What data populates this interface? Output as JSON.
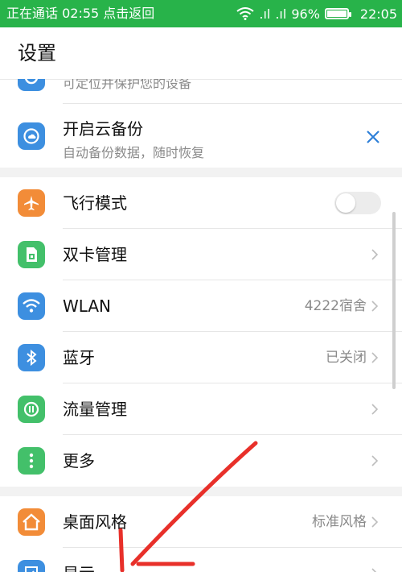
{
  "status_bar": {
    "left_text": "正在通话 02:55 点击返回",
    "signal_1": ".ıl",
    "signal_2": ".ıl",
    "battery_percent": "96%",
    "time": "22:05"
  },
  "header": {
    "title": "设置"
  },
  "partial_row": {
    "subtitle": "可定位并保护您的设备"
  },
  "cloud_backup": {
    "title": "开启云备份",
    "subtitle": "自动备份数据，随时恢复"
  },
  "network_section": [
    {
      "label": "飞行模式",
      "icon": "airplane-icon",
      "color": "#f28c38",
      "toggle_on": false
    },
    {
      "label": "双卡管理",
      "icon": "sim-card-icon",
      "color": "#43c06a"
    },
    {
      "label": "WLAN",
      "icon": "wifi-icon",
      "color": "#3d8fe0",
      "value": "4222宿舍"
    },
    {
      "label": "蓝牙",
      "icon": "bluetooth-icon",
      "color": "#3d8fe0",
      "value": "已关闭"
    },
    {
      "label": "流量管理",
      "icon": "data-usage-icon",
      "color": "#43c06a"
    },
    {
      "label": "更多",
      "icon": "more-icon",
      "color": "#43c06a"
    }
  ],
  "display_section": [
    {
      "label": "桌面风格",
      "icon": "home-icon",
      "color": "#f28c38",
      "value": "标准风格"
    },
    {
      "label": "显示",
      "icon": "display-icon",
      "color": "#3d8fe0"
    }
  ],
  "colors": {
    "status_bar": "#28b34a",
    "accent": "#2d7fd8",
    "annotation": "#e8302a"
  }
}
